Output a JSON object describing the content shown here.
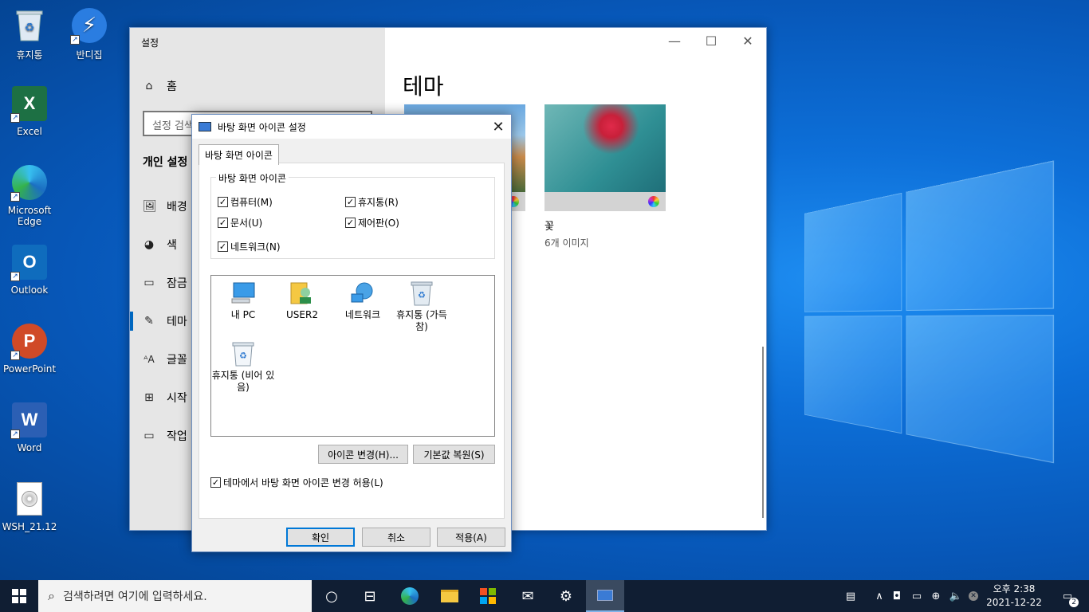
{
  "desktop": {
    "icons": [
      {
        "label": "휴지통",
        "icon": "recycle-bin-icon"
      },
      {
        "label": "반디집",
        "icon": "bandizip-icon"
      },
      {
        "label": "Excel",
        "icon": "excel-icon"
      },
      {
        "label": "Microsoft Edge",
        "icon": "edge-icon"
      },
      {
        "label": "Outlook",
        "icon": "outlook-icon"
      },
      {
        "label": "PowerPoint",
        "icon": "powerpoint-icon"
      },
      {
        "label": "Word",
        "icon": "word-icon"
      },
      {
        "label": "WSH_21.12",
        "icon": "disc-image-file-icon"
      }
    ]
  },
  "settings": {
    "title": "설정",
    "home": "홈",
    "search_placeholder": "설정 검색",
    "section": "개인 설정",
    "nav": [
      "배경",
      "색",
      "잠금",
      "테마",
      "글꼴",
      "시작",
      "작업"
    ],
    "selected_nav": "테마",
    "page_title": "테마",
    "themes": [
      {
        "name": "",
        "sub": ""
      },
      {
        "name": "꽃",
        "sub": "6개 이미지"
      }
    ]
  },
  "dialog": {
    "title": "바탕 화면 아이콘 설정",
    "tab": "바탕 화면 아이콘",
    "group_label": "바탕 화면 아이콘",
    "checkboxes": [
      {
        "label": "컴퓨터(M)",
        "checked": true
      },
      {
        "label": "휴지통(R)",
        "checked": true
      },
      {
        "label": "문서(U)",
        "checked": true
      },
      {
        "label": "제어판(O)",
        "checked": true
      },
      {
        "label": "네트워크(N)",
        "checked": true
      }
    ],
    "icons": [
      {
        "label": "내 PC",
        "icon": "computer-icon"
      },
      {
        "label": "USER2",
        "icon": "user-folder-icon"
      },
      {
        "label": "네트워크",
        "icon": "network-icon"
      },
      {
        "label": "휴지통 (가득 참)",
        "icon": "recycle-bin-full-icon"
      },
      {
        "label": "휴지통 (비어 있음)",
        "icon": "recycle-bin-empty-icon"
      }
    ],
    "change_icon": "아이콘 변경(H)...",
    "restore_default": "기본값 복원(S)",
    "allow_themes": "테마에서 바탕 화면 아이콘 변경 허용(L)",
    "allow_themes_checked": true,
    "ok": "확인",
    "cancel": "취소",
    "apply": "적용(A)"
  },
  "taskbar": {
    "search_placeholder": "검색하려면 여기에 입력하세요.",
    "time": "오후 2:38",
    "date": "2021-12-22",
    "notification_count": "2"
  }
}
